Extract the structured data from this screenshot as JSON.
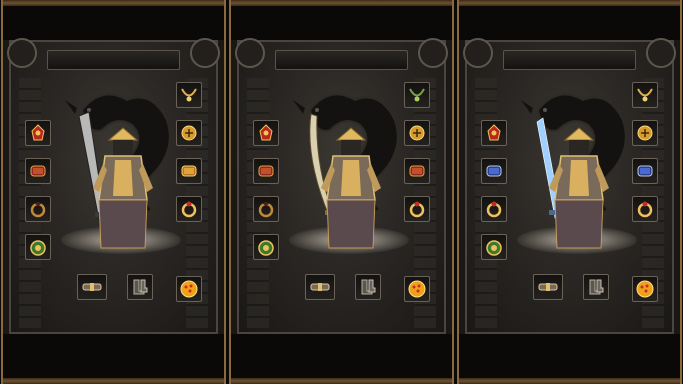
{
  "panels": [
    {
      "id": "panel-1",
      "weapon": "greatsword",
      "weapon_color": "#b8b8b8",
      "slots": {
        "left": [
          "helmet-red-icon",
          "bracer-red-icon",
          "ring-dark-icon",
          "medal-green-icon"
        ],
        "right": [
          "necklace-gold-icon",
          "bracelet-gold-icon",
          "bracer-gold-icon",
          "ring-gold-icon",
          "orb-gold-icon"
        ],
        "bottom": [
          "belt-icon",
          "boots-icon"
        ]
      }
    },
    {
      "id": "panel-2",
      "weapon": "curved-blade",
      "weapon_color": "#d8d0b0",
      "slots": {
        "left": [
          "helmet-red-icon",
          "bracer-red-icon",
          "ring-dark-icon",
          "medal-green-icon"
        ],
        "right": [
          "necklace-green-icon",
          "bracelet-gold-icon",
          "bracer-red-icon",
          "ring-gold-icon",
          "orb-gold-icon"
        ],
        "bottom": [
          "belt-icon",
          "boots-icon"
        ]
      }
    },
    {
      "id": "panel-3",
      "weapon": "ice-sword",
      "weapon_color": "#9fd0ff",
      "slots": {
        "left": [
          "helmet-red-icon",
          "bracer-blue-icon",
          "ring-gold-icon",
          "medal-green-icon"
        ],
        "right": [
          "necklace-gold-icon",
          "bracelet-gold-icon",
          "bracer-blue-icon",
          "ring-gold-icon",
          "orb-gold-icon"
        ],
        "bottom": [
          "belt-icon",
          "boots-icon"
        ]
      }
    }
  ],
  "colors": {
    "frame_gold": "#8a6a3c",
    "slot_border": "#6a6258",
    "panel_bg": "#1a1714"
  }
}
